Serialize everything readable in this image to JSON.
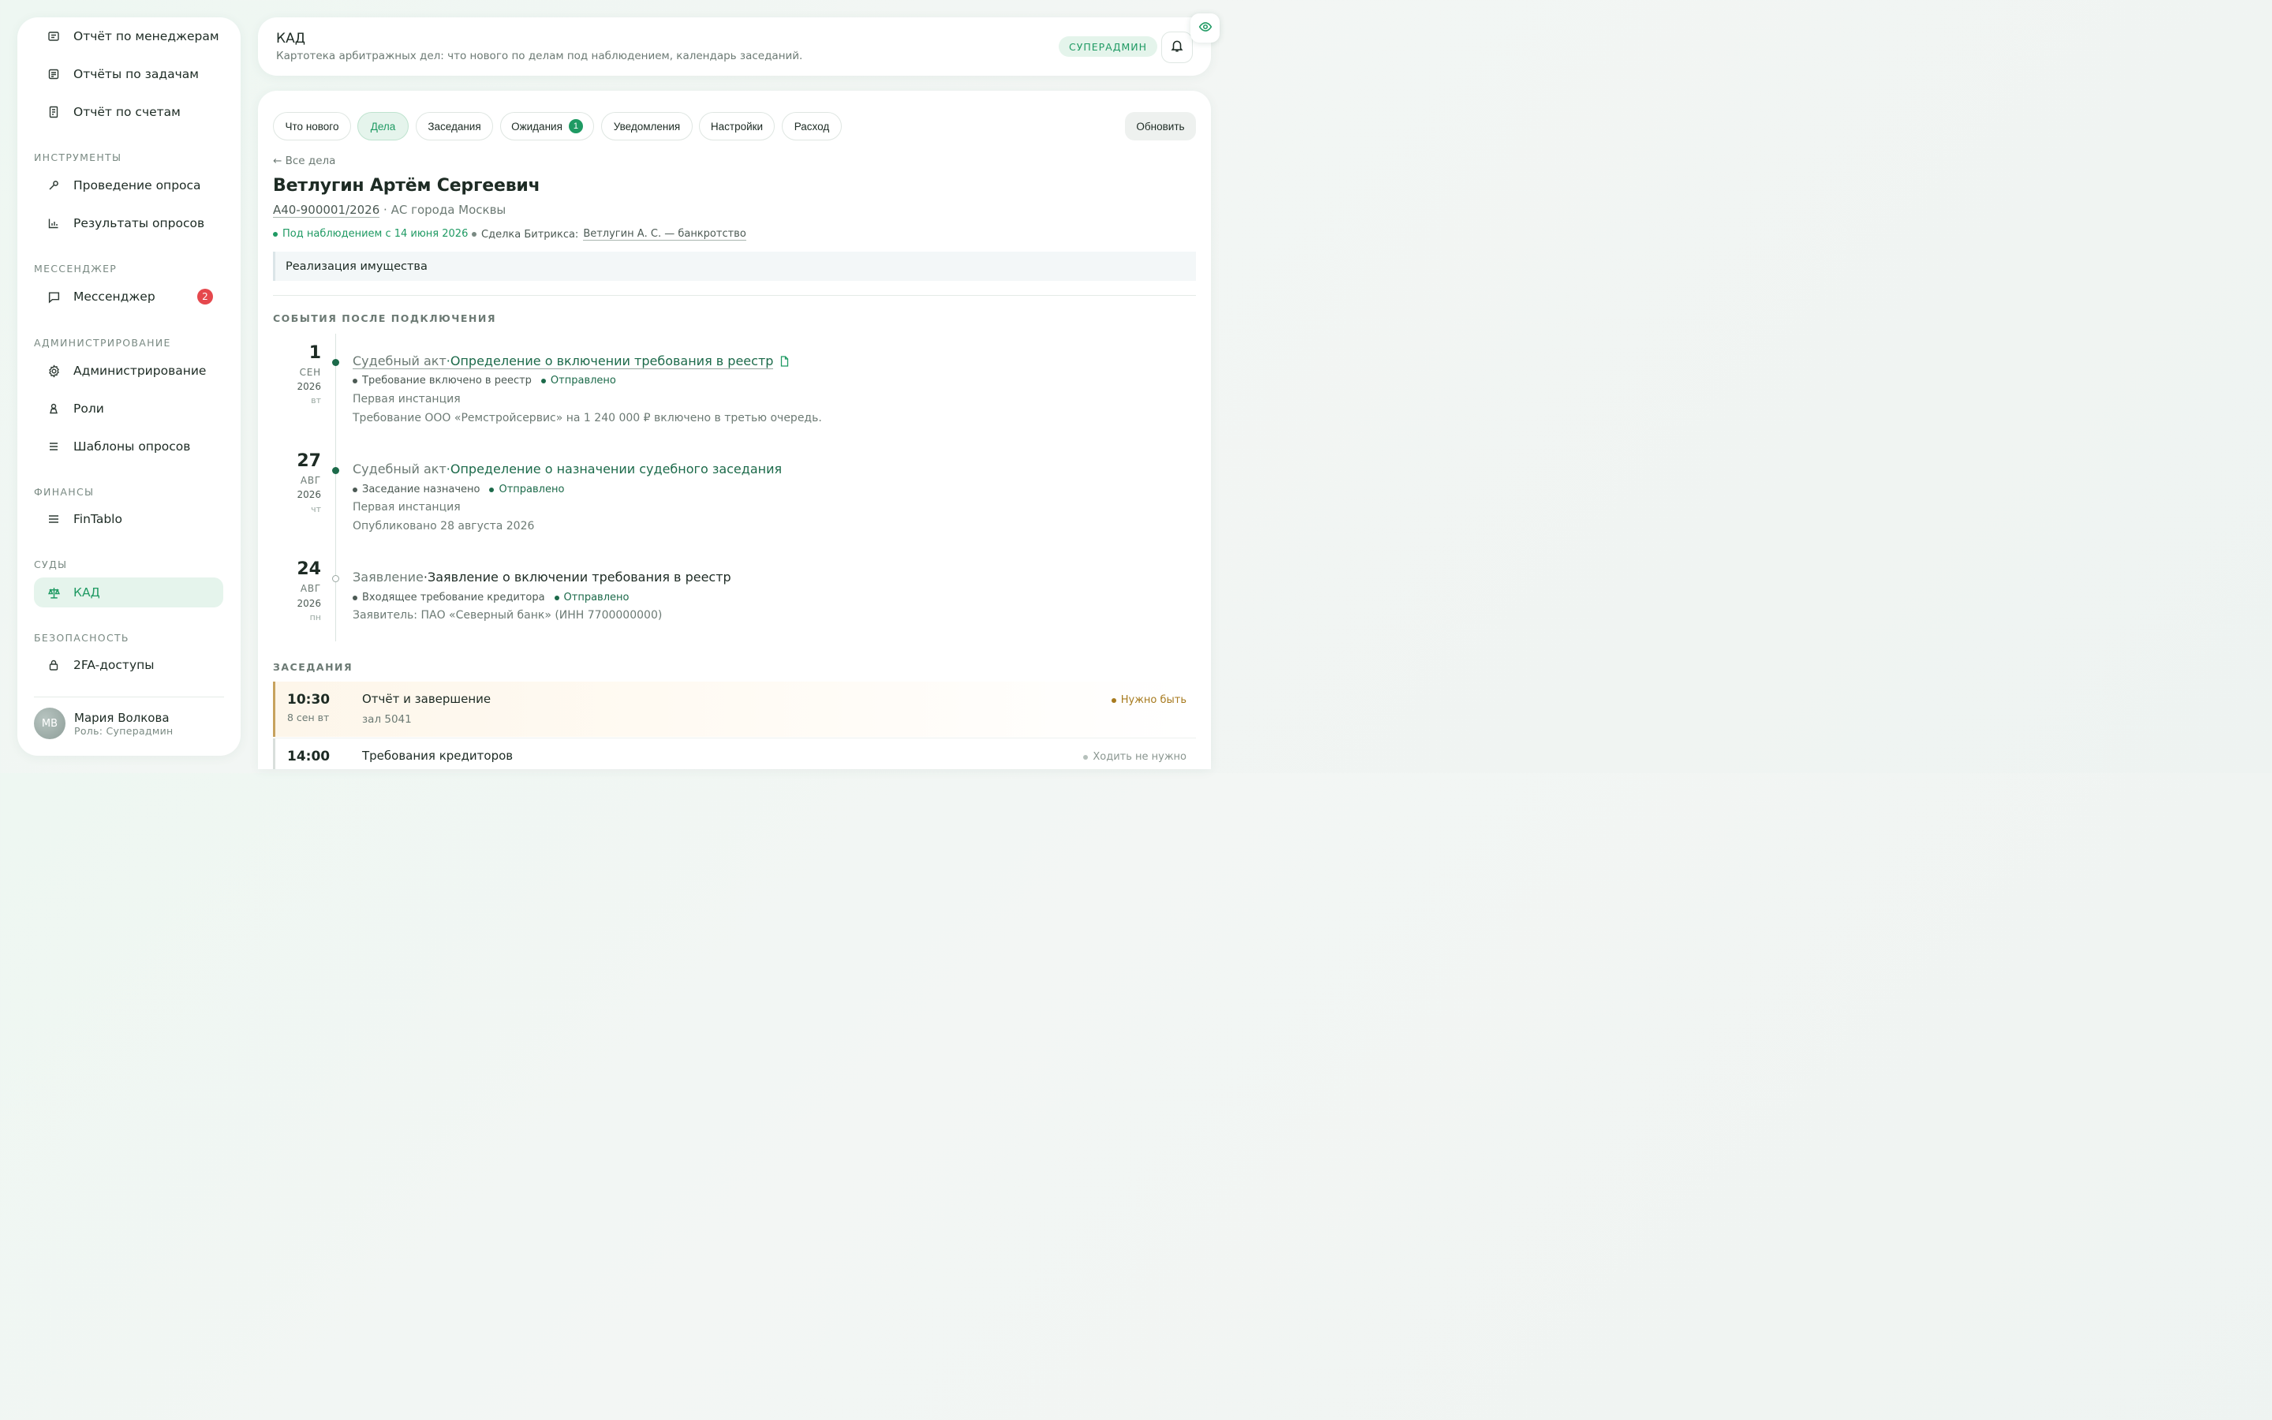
{
  "sidebar": {
    "items_top": [
      {
        "label": "Отчёт по менеджерам",
        "icon": "report-icon"
      },
      {
        "label": "Отчёты по задачам",
        "icon": "tasks-report-icon"
      },
      {
        "label": "Отчёт по счетам",
        "icon": "invoice-icon"
      }
    ],
    "sections": {
      "tools": "ИНСТРУМЕНТЫ",
      "messenger": "МЕССЕНДЖЕР",
      "admin": "АДМИНИСТРИРОВАНИЕ",
      "finance": "ФИНАНСЫ",
      "courts": "СУДЫ",
      "security": "БЕЗОПАСНОСТЬ"
    },
    "tools": [
      {
        "label": "Проведение опроса",
        "icon": "wrench-icon"
      },
      {
        "label": "Результаты опросов",
        "icon": "bar-chart-icon"
      }
    ],
    "messenger": {
      "label": "Мессенджер",
      "icon": "chat-icon",
      "badge": "2"
    },
    "admin": [
      {
        "label": "Администрирование",
        "icon": "gear-icon"
      },
      {
        "label": "Роли",
        "icon": "person-icon"
      },
      {
        "label": "Шаблоны опросов",
        "icon": "list-icon"
      }
    ],
    "finance": {
      "label": "FinTablo",
      "icon": "menu-lines-icon"
    },
    "courts": {
      "label": "КАД",
      "icon": "scales-icon",
      "active": true
    },
    "security": {
      "label": "2FA-доступы",
      "icon": "lock-icon"
    },
    "user": {
      "initials": "МВ",
      "name": "Мария Волкова",
      "role": "Роль: Суперадмин"
    }
  },
  "header": {
    "title": "КАД",
    "subtitle": "Картотека арбитражных дел: что нового по делам под наблюдением, календарь заседаний.",
    "role_badge": "СУПЕРАДМИН"
  },
  "tabs": [
    {
      "label": "Что нового"
    },
    {
      "label": "Дела",
      "active": true
    },
    {
      "label": "Заседания"
    },
    {
      "label": "Ожидания",
      "count": "1"
    },
    {
      "label": "Уведомления"
    },
    {
      "label": "Настройки"
    },
    {
      "label": "Расход"
    }
  ],
  "refresh_label": "Обновить",
  "case": {
    "back_label": "← Все дела",
    "title": "Ветлугин Артём Сергеевич",
    "number": "А40-900001/2026",
    "court": "· АС города Москвы",
    "watch": "Под наблюдением с 14 июня 2026",
    "deal_label": "Сделка Битрикса:",
    "deal_link": "Ветлугин А. С. — банкротство",
    "stage": "Реализация имущества"
  },
  "events_title": "СОБЫТИЯ ПОСЛЕ ПОДКЛЮЧЕНИЯ",
  "events": [
    {
      "day": "1",
      "month": "СЕН",
      "year": "2026",
      "dow": "вт",
      "kind": "Судебный акт",
      "sep": " · ",
      "title": "Определение о включении требования в реестр",
      "tag": "Требование включено в реестр",
      "status": "Отправлено",
      "line1": "Первая инстанция",
      "line2": "Требование ООО «Ремстройсервис» на 1 240 000 ₽ включено в третью очередь."
    },
    {
      "day": "27",
      "month": "АВГ",
      "year": "2026",
      "dow": "чт",
      "kind": "Судебный акт",
      "sep": " · ",
      "title": "Определение о назначении судебного заседания",
      "tag": "Заседание назначено",
      "status": "Отправлено",
      "line1": "Первая инстанция",
      "line2": "Опубликовано 28 августа 2026"
    },
    {
      "day": "24",
      "month": "АВГ",
      "year": "2026",
      "dow": "пн",
      "kind": "Заявление",
      "sep": " · ",
      "title": "Заявление о включении требования в реестр",
      "tag": "Входящее требование кредитора",
      "status": "Отправлено",
      "line1": "Заявитель: ПАО «Северный банк» (ИНН 7700000000)"
    }
  ],
  "hearings_title": "ЗАСЕДАНИЯ",
  "hearings": [
    {
      "time": "10:30",
      "date": "8 сен вт",
      "title": "Отчёт и завершение",
      "room": "зал 5041",
      "status": "Нужно быть"
    },
    {
      "time": "14:00",
      "title": "Требования кредиторов",
      "status": "Ходить не нужно"
    }
  ],
  "colors": {
    "accent": "#1f9a63",
    "accent_dark": "#1c6a4a",
    "warning": "#a77a1e",
    "badge_red": "#e5484d"
  }
}
